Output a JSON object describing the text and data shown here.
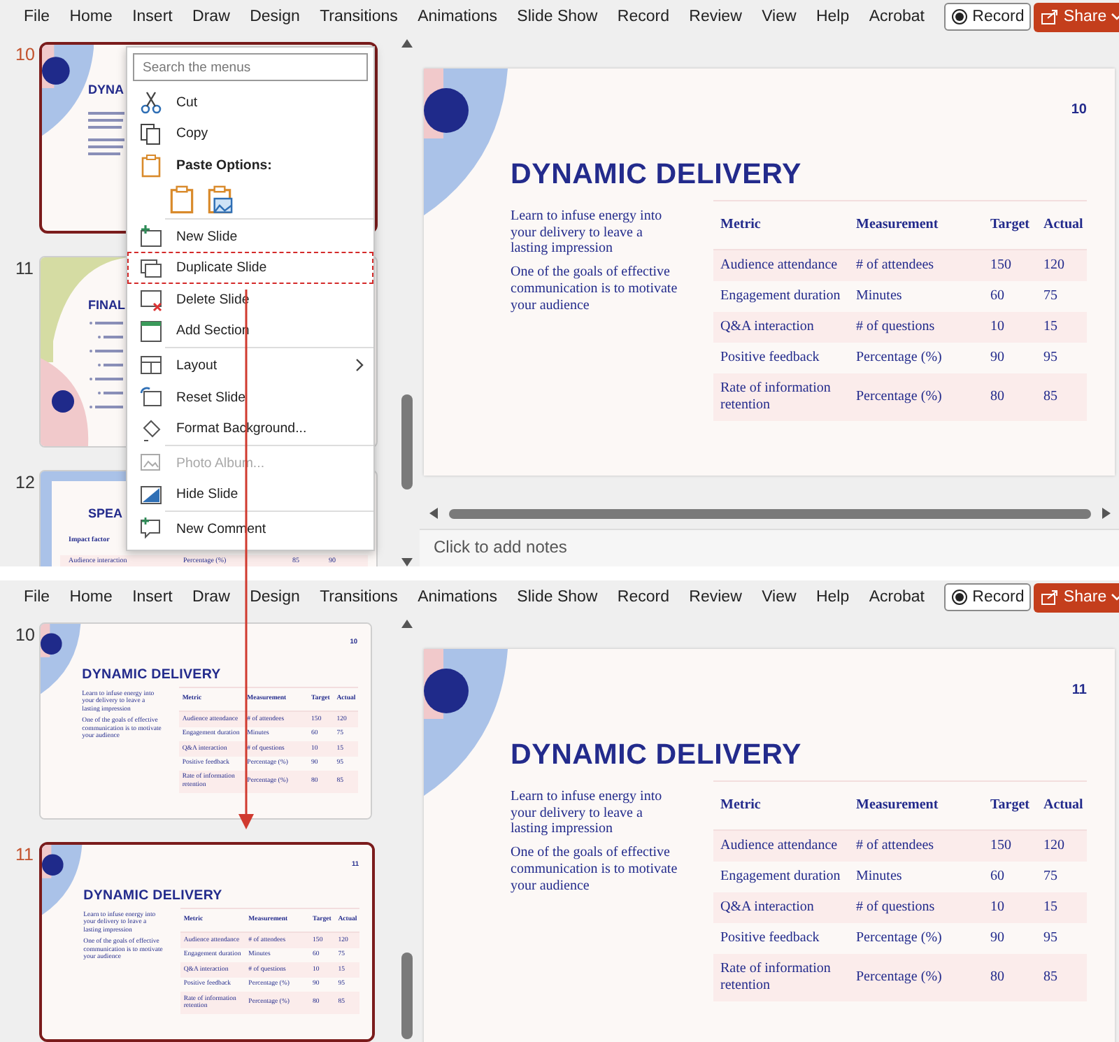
{
  "screens": [
    {
      "menu_tabs": [
        "File",
        "Home",
        "Insert",
        "Draw",
        "Design",
        "Transitions",
        "Animations",
        "Slide Show",
        "Record",
        "Review",
        "View",
        "Help",
        "Acrobat"
      ],
      "record_button": "Record",
      "share_button": "Share",
      "thumbnails": [
        {
          "number": "10",
          "selected": true,
          "kind": "cover",
          "title": "DYNA"
        },
        {
          "number": "11",
          "selected": false,
          "kind": "bullets",
          "title": "FINAL"
        },
        {
          "number": "12",
          "selected": false,
          "kind": "table",
          "title": "SPEA",
          "rows": [
            [
              "Impact factor"
            ],
            [
              "Audience interaction",
              "Percentage (%)",
              "85",
              "90"
            ]
          ]
        }
      ],
      "slide": {
        "number": "10",
        "title": "DYNAMIC DELIVERY",
        "paragraphs": [
          "Learn to infuse energy into your delivery to leave a lasting impression",
          "One of the goals of effective communication is to motivate your audience"
        ],
        "table": {
          "columns": [
            "Metric",
            "Measurement",
            "Target",
            "Actual"
          ],
          "rows": [
            [
              "Audience attendance",
              "# of attendees",
              "150",
              "120"
            ],
            [
              "Engagement duration",
              "Minutes",
              "60",
              "75"
            ],
            [
              "Q&A interaction",
              "# of questions",
              "10",
              "15"
            ],
            [
              "Positive feedback",
              "Percentage (%)",
              "90",
              "95"
            ],
            [
              "Rate of information retention",
              "Percentage (%)",
              "80",
              "85"
            ]
          ]
        }
      },
      "notes_placeholder": "Click to add notes",
      "context_menu": {
        "placeholder": "Search the menus",
        "items": [
          {
            "kind": "command",
            "label": "Cut",
            "selected": false,
            "disabled": false
          },
          {
            "kind": "command",
            "label": "Copy",
            "selected": false,
            "disabled": false
          },
          {
            "kind": "heading",
            "label": "Paste Options:"
          },
          {
            "kind": "paste-icons"
          },
          {
            "kind": "separator"
          },
          {
            "kind": "command",
            "label": "New Slide",
            "selected": false,
            "disabled": false
          },
          {
            "kind": "command",
            "label": "Duplicate Slide",
            "selected": true,
            "disabled": false
          },
          {
            "kind": "command",
            "label": "Delete Slide",
            "selected": false,
            "disabled": false
          },
          {
            "kind": "command",
            "label": "Add Section",
            "selected": false,
            "disabled": false
          },
          {
            "kind": "separator"
          },
          {
            "kind": "submenu",
            "label": "Layout",
            "selected": false,
            "disabled": false
          },
          {
            "kind": "command",
            "label": "Reset Slide",
            "selected": false,
            "disabled": false
          },
          {
            "kind": "command",
            "label": "Format Background...",
            "selected": false,
            "disabled": false
          },
          {
            "kind": "separator"
          },
          {
            "kind": "command",
            "label": "Photo Album...",
            "selected": false,
            "disabled": true
          },
          {
            "kind": "command",
            "label": "Hide Slide",
            "selected": false,
            "disabled": false
          },
          {
            "kind": "separator"
          },
          {
            "kind": "command",
            "label": "New Comment",
            "selected": false,
            "disabled": false
          }
        ]
      }
    },
    {
      "menu_tabs": [
        "File",
        "Home",
        "Insert",
        "Draw",
        "Design",
        "Transitions",
        "Animations",
        "Slide Show",
        "Record",
        "Review",
        "View",
        "Help",
        "Acrobat"
      ],
      "record_button": "Record",
      "share_button": "Share",
      "thumbnails": [
        {
          "number": "10",
          "selected": false,
          "kind": "slide",
          "slide": {
            "number": "10",
            "title": "DYNAMIC DELIVERY",
            "paragraphs": [
              "Learn to infuse energy into your delivery to leave a lasting impression",
              "One of the goals of effective communication is to motivate your audience"
            ],
            "table": {
              "columns": [
                "Metric",
                "Measurement",
                "Target",
                "Actual"
              ],
              "rows": [
                [
                  "Audience attendance",
                  "# of attendees",
                  "150",
                  "120"
                ],
                [
                  "Engagement duration",
                  "Minutes",
                  "60",
                  "75"
                ],
                [
                  "Q&A interaction",
                  "# of questions",
                  "10",
                  "15"
                ],
                [
                  "Positive feedback",
                  "Percentage (%)",
                  "90",
                  "95"
                ],
                [
                  "Rate of information retention",
                  "Percentage (%)",
                  "80",
                  "85"
                ]
              ]
            }
          }
        },
        {
          "number": "11",
          "selected": true,
          "kind": "slide",
          "slide": {
            "number": "11",
            "title": "DYNAMIC DELIVERY",
            "paragraphs": [
              "Learn to infuse energy into your delivery to leave a lasting impression",
              "One of the goals of effective communication is to motivate your audience"
            ],
            "table": {
              "columns": [
                "Metric",
                "Measurement",
                "Target",
                "Actual"
              ],
              "rows": [
                [
                  "Audience attendance",
                  "# of attendees",
                  "150",
                  "120"
                ],
                [
                  "Engagement duration",
                  "Minutes",
                  "60",
                  "75"
                ],
                [
                  "Q&A interaction",
                  "# of questions",
                  "10",
                  "15"
                ],
                [
                  "Positive feedback",
                  "Percentage (%)",
                  "90",
                  "95"
                ],
                [
                  "Rate of information retention",
                  "Percentage (%)",
                  "80",
                  "85"
                ]
              ]
            }
          }
        }
      ],
      "slide": {
        "number": "11",
        "title": "DYNAMIC DELIVERY",
        "paragraphs": [
          "Learn to infuse energy into your delivery to leave a lasting impression",
          "One of the goals of effective communication is to motivate your audience"
        ],
        "table": {
          "columns": [
            "Metric",
            "Measurement",
            "Target",
            "Actual"
          ],
          "rows": [
            [
              "Audience attendance",
              "# of attendees",
              "150",
              "120"
            ],
            [
              "Engagement duration",
              "Minutes",
              "60",
              "75"
            ],
            [
              "Q&A interaction",
              "# of questions",
              "10",
              "15"
            ],
            [
              "Positive feedback",
              "Percentage (%)",
              "90",
              "95"
            ],
            [
              "Rate of information retention",
              "Percentage (%)",
              "80",
              "85"
            ]
          ]
        }
      }
    }
  ]
}
